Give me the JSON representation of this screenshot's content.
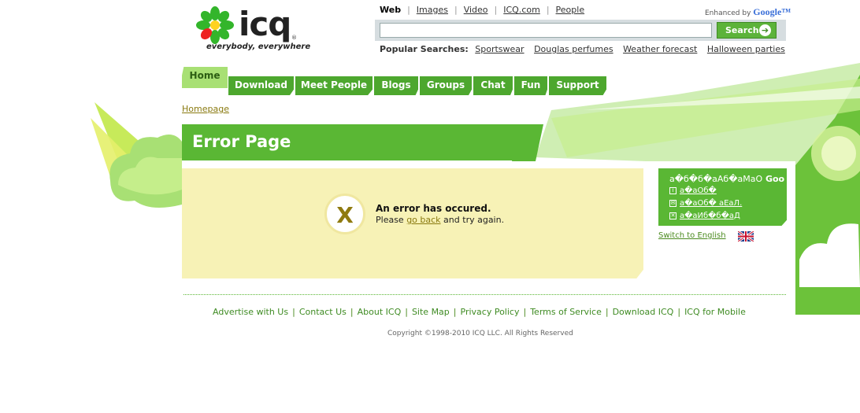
{
  "header": {
    "logo_text": "icq",
    "logo_reg": "®",
    "tagline": "everybody, everywhere"
  },
  "search": {
    "tabs": [
      "Web",
      "Images",
      "Video",
      "ICQ.com",
      "People"
    ],
    "enhanced_label": "Enhanced by",
    "enhanced_brand": "Google™",
    "input_value": "",
    "button_label": "Search",
    "popular_label": "Popular Searches:",
    "popular": [
      "Sportswear",
      "Douglas perfumes",
      "Weather forecast",
      "Halloween parties"
    ]
  },
  "nav": {
    "items": [
      "Home",
      "Download",
      "Meet People",
      "Blogs",
      "Groups",
      "Chat",
      "Fun",
      "Support"
    ]
  },
  "breadcrumb": "Homepage",
  "page_title": "Error Page",
  "error": {
    "title": "An error has occured.",
    "msg_before": "Please ",
    "link": "go back",
    "msg_after": " and try again."
  },
  "lang_box": {
    "title": "а�б�б�аАб�аМаО",
    "title_bold": " Goo",
    "links": [
      "а�аОб�",
      "а�аОб� аЕаЛ.",
      "а�аИб�б�аД"
    ]
  },
  "switch_english": "Switch to English",
  "footer": {
    "links": [
      "Advertise with Us",
      "Contact Us",
      "About ICQ",
      "Site Map",
      "Privacy Policy",
      "Terms of Service",
      "Download ICQ",
      "ICQ for Mobile"
    ],
    "copyright": "Copyright ©1998-2010 ICQ LLC. All Rights Reserved"
  },
  "colors": {
    "brand_green": "#5ab734",
    "panel_yellow": "#f7f2b6",
    "link_olive": "#8a7a10"
  }
}
